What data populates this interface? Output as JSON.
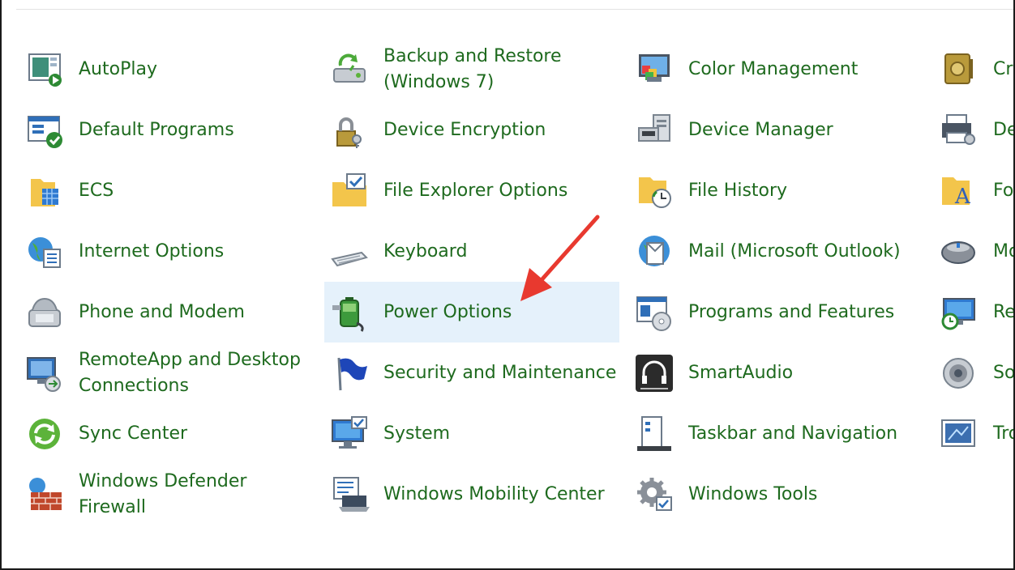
{
  "accent_link_color": "#1e6a1e",
  "selected_background": "#e5f1fb",
  "arrow_color": "#e8392f",
  "columns": [
    [
      {
        "label": "AutoPlay",
        "icon": "autoplay-icon"
      },
      {
        "label": "Default Programs",
        "icon": "default-programs-icon"
      },
      {
        "label": "ECS",
        "icon": "ecs-folder-icon"
      },
      {
        "label": "Internet Options",
        "icon": "internet-options-icon"
      },
      {
        "label": "Phone and Modem",
        "icon": "phone-modem-icon"
      },
      {
        "label": "RemoteApp and Desktop\nConnections",
        "icon": "remoteapp-icon"
      },
      {
        "label": "Sync Center",
        "icon": "sync-center-icon"
      },
      {
        "label": "Windows Defender\nFirewall",
        "icon": "firewall-icon"
      }
    ],
    [
      {
        "label": "Backup and Restore\n(Windows 7)",
        "icon": "backup-restore-icon"
      },
      {
        "label": "Device Encryption",
        "icon": "device-encryption-icon"
      },
      {
        "label": "File Explorer Options",
        "icon": "file-explorer-options-icon"
      },
      {
        "label": "Keyboard",
        "icon": "keyboard-icon"
      },
      {
        "label": "Power Options",
        "icon": "power-options-icon",
        "selected": true
      },
      {
        "label": "Security and Maintenance",
        "icon": "security-flag-icon"
      },
      {
        "label": "System",
        "icon": "system-icon"
      },
      {
        "label": "Windows Mobility Center",
        "icon": "mobility-center-icon"
      }
    ],
    [
      {
        "label": "Color Management",
        "icon": "color-management-icon"
      },
      {
        "label": "Device Manager",
        "icon": "device-manager-icon"
      },
      {
        "label": "File History",
        "icon": "file-history-icon"
      },
      {
        "label": "Mail (Microsoft Outlook)",
        "icon": "mail-icon"
      },
      {
        "label": "Programs and Features",
        "icon": "programs-features-icon"
      },
      {
        "label": "SmartAudio",
        "icon": "smartaudio-icon"
      },
      {
        "label": "Taskbar and Navigation",
        "icon": "taskbar-icon"
      },
      {
        "label": "Windows Tools",
        "icon": "windows-tools-icon"
      }
    ],
    [
      {
        "label": "Cre",
        "icon": "credential-manager-icon"
      },
      {
        "label": "De",
        "icon": "devices-printers-icon"
      },
      {
        "label": "Fo",
        "icon": "fonts-icon"
      },
      {
        "label": "Mo",
        "icon": "mouse-icon"
      },
      {
        "label": "Re",
        "icon": "recovery-icon"
      },
      {
        "label": "Sou",
        "icon": "sound-icon"
      },
      {
        "label": "Tro",
        "icon": "troubleshooting-icon"
      }
    ]
  ]
}
